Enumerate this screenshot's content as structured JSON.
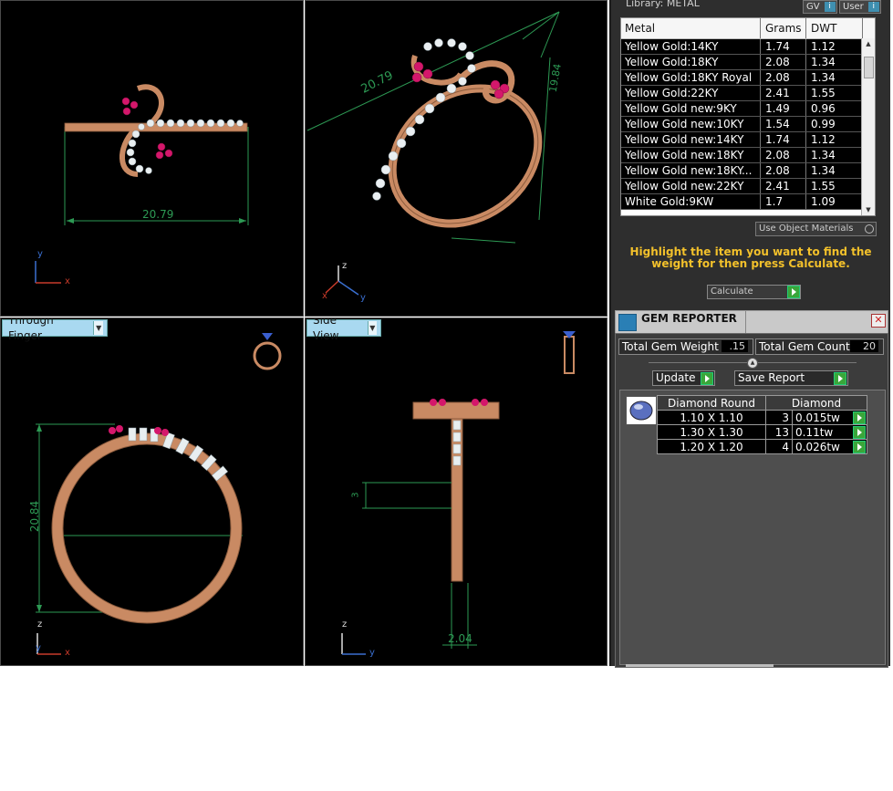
{
  "viewports": {
    "top_left": {
      "dimension": "20.79",
      "axes": [
        "y",
        "x"
      ]
    },
    "top_right": {
      "dimension_diagonal": "20.79",
      "dimension_side": "19.84",
      "axes": [
        "z",
        "x",
        "y"
      ]
    },
    "bottom_left": {
      "tab_label": "Through Finger",
      "dimension": "20.84",
      "axes": [
        "z",
        "y",
        "x"
      ]
    },
    "bottom_right": {
      "tab_label": "Side View",
      "dimension_small": "3",
      "dimension_width": "2.04",
      "axes": [
        "z",
        "y"
      ]
    }
  },
  "library": {
    "title": "Library: METAL",
    "gv_label": "GV",
    "user_label": "User",
    "columns": [
      "Metal",
      "Grams",
      "DWT"
    ],
    "rows": [
      {
        "metal": "Yellow Gold:14KY",
        "grams": "1.74",
        "dwt": "1.12"
      },
      {
        "metal": "Yellow Gold:18KY",
        "grams": "2.08",
        "dwt": "1.34"
      },
      {
        "metal": "Yellow Gold:18KY Royal",
        "grams": "2.08",
        "dwt": "1.34"
      },
      {
        "metal": "Yellow Gold:22KY",
        "grams": "2.41",
        "dwt": "1.55"
      },
      {
        "metal": "Yellow Gold new:9KY",
        "grams": "1.49",
        "dwt": "0.96"
      },
      {
        "metal": "Yellow Gold new:10KY",
        "grams": "1.54",
        "dwt": "0.99"
      },
      {
        "metal": "Yellow Gold new:14KY",
        "grams": "1.74",
        "dwt": "1.12"
      },
      {
        "metal": "Yellow Gold new:18KY",
        "grams": "2.08",
        "dwt": "1.34"
      },
      {
        "metal": "Yellow Gold new:18KY...",
        "grams": "2.08",
        "dwt": "1.34"
      },
      {
        "metal": "Yellow Gold new:22KY",
        "grams": "2.41",
        "dwt": "1.55"
      },
      {
        "metal": "White Gold:9KW",
        "grams": "1.7",
        "dwt": "1.09"
      }
    ],
    "use_object_materials": "Use Object Materials",
    "hint": "Highlight the item you want to find the weight for then press Calculate.",
    "calculate_label": "Calculate"
  },
  "gem_reporter": {
    "title": "GEM REPORTER",
    "total_weight_label": "Total Gem Weight",
    "total_weight_value": ".15",
    "total_count_label": "Total Gem Count",
    "total_count_value": "20",
    "update_label": "Update",
    "save_report_label": "Save Report",
    "table_header": [
      "Diamond Round",
      "Diamond"
    ],
    "rows": [
      {
        "size": "1.10 X 1.10",
        "count": "3",
        "weight": "0.015tw"
      },
      {
        "size": "1.30 X 1.30",
        "count": "13",
        "weight": "0.11tw"
      },
      {
        "size": "1.20 X 1.20",
        "count": "4",
        "weight": "0.026tw"
      }
    ]
  },
  "colors": {
    "gold": "#c98a63",
    "ruby": "#d4176b",
    "dimension": "#2d9a54",
    "hint": "#f3c12b"
  }
}
